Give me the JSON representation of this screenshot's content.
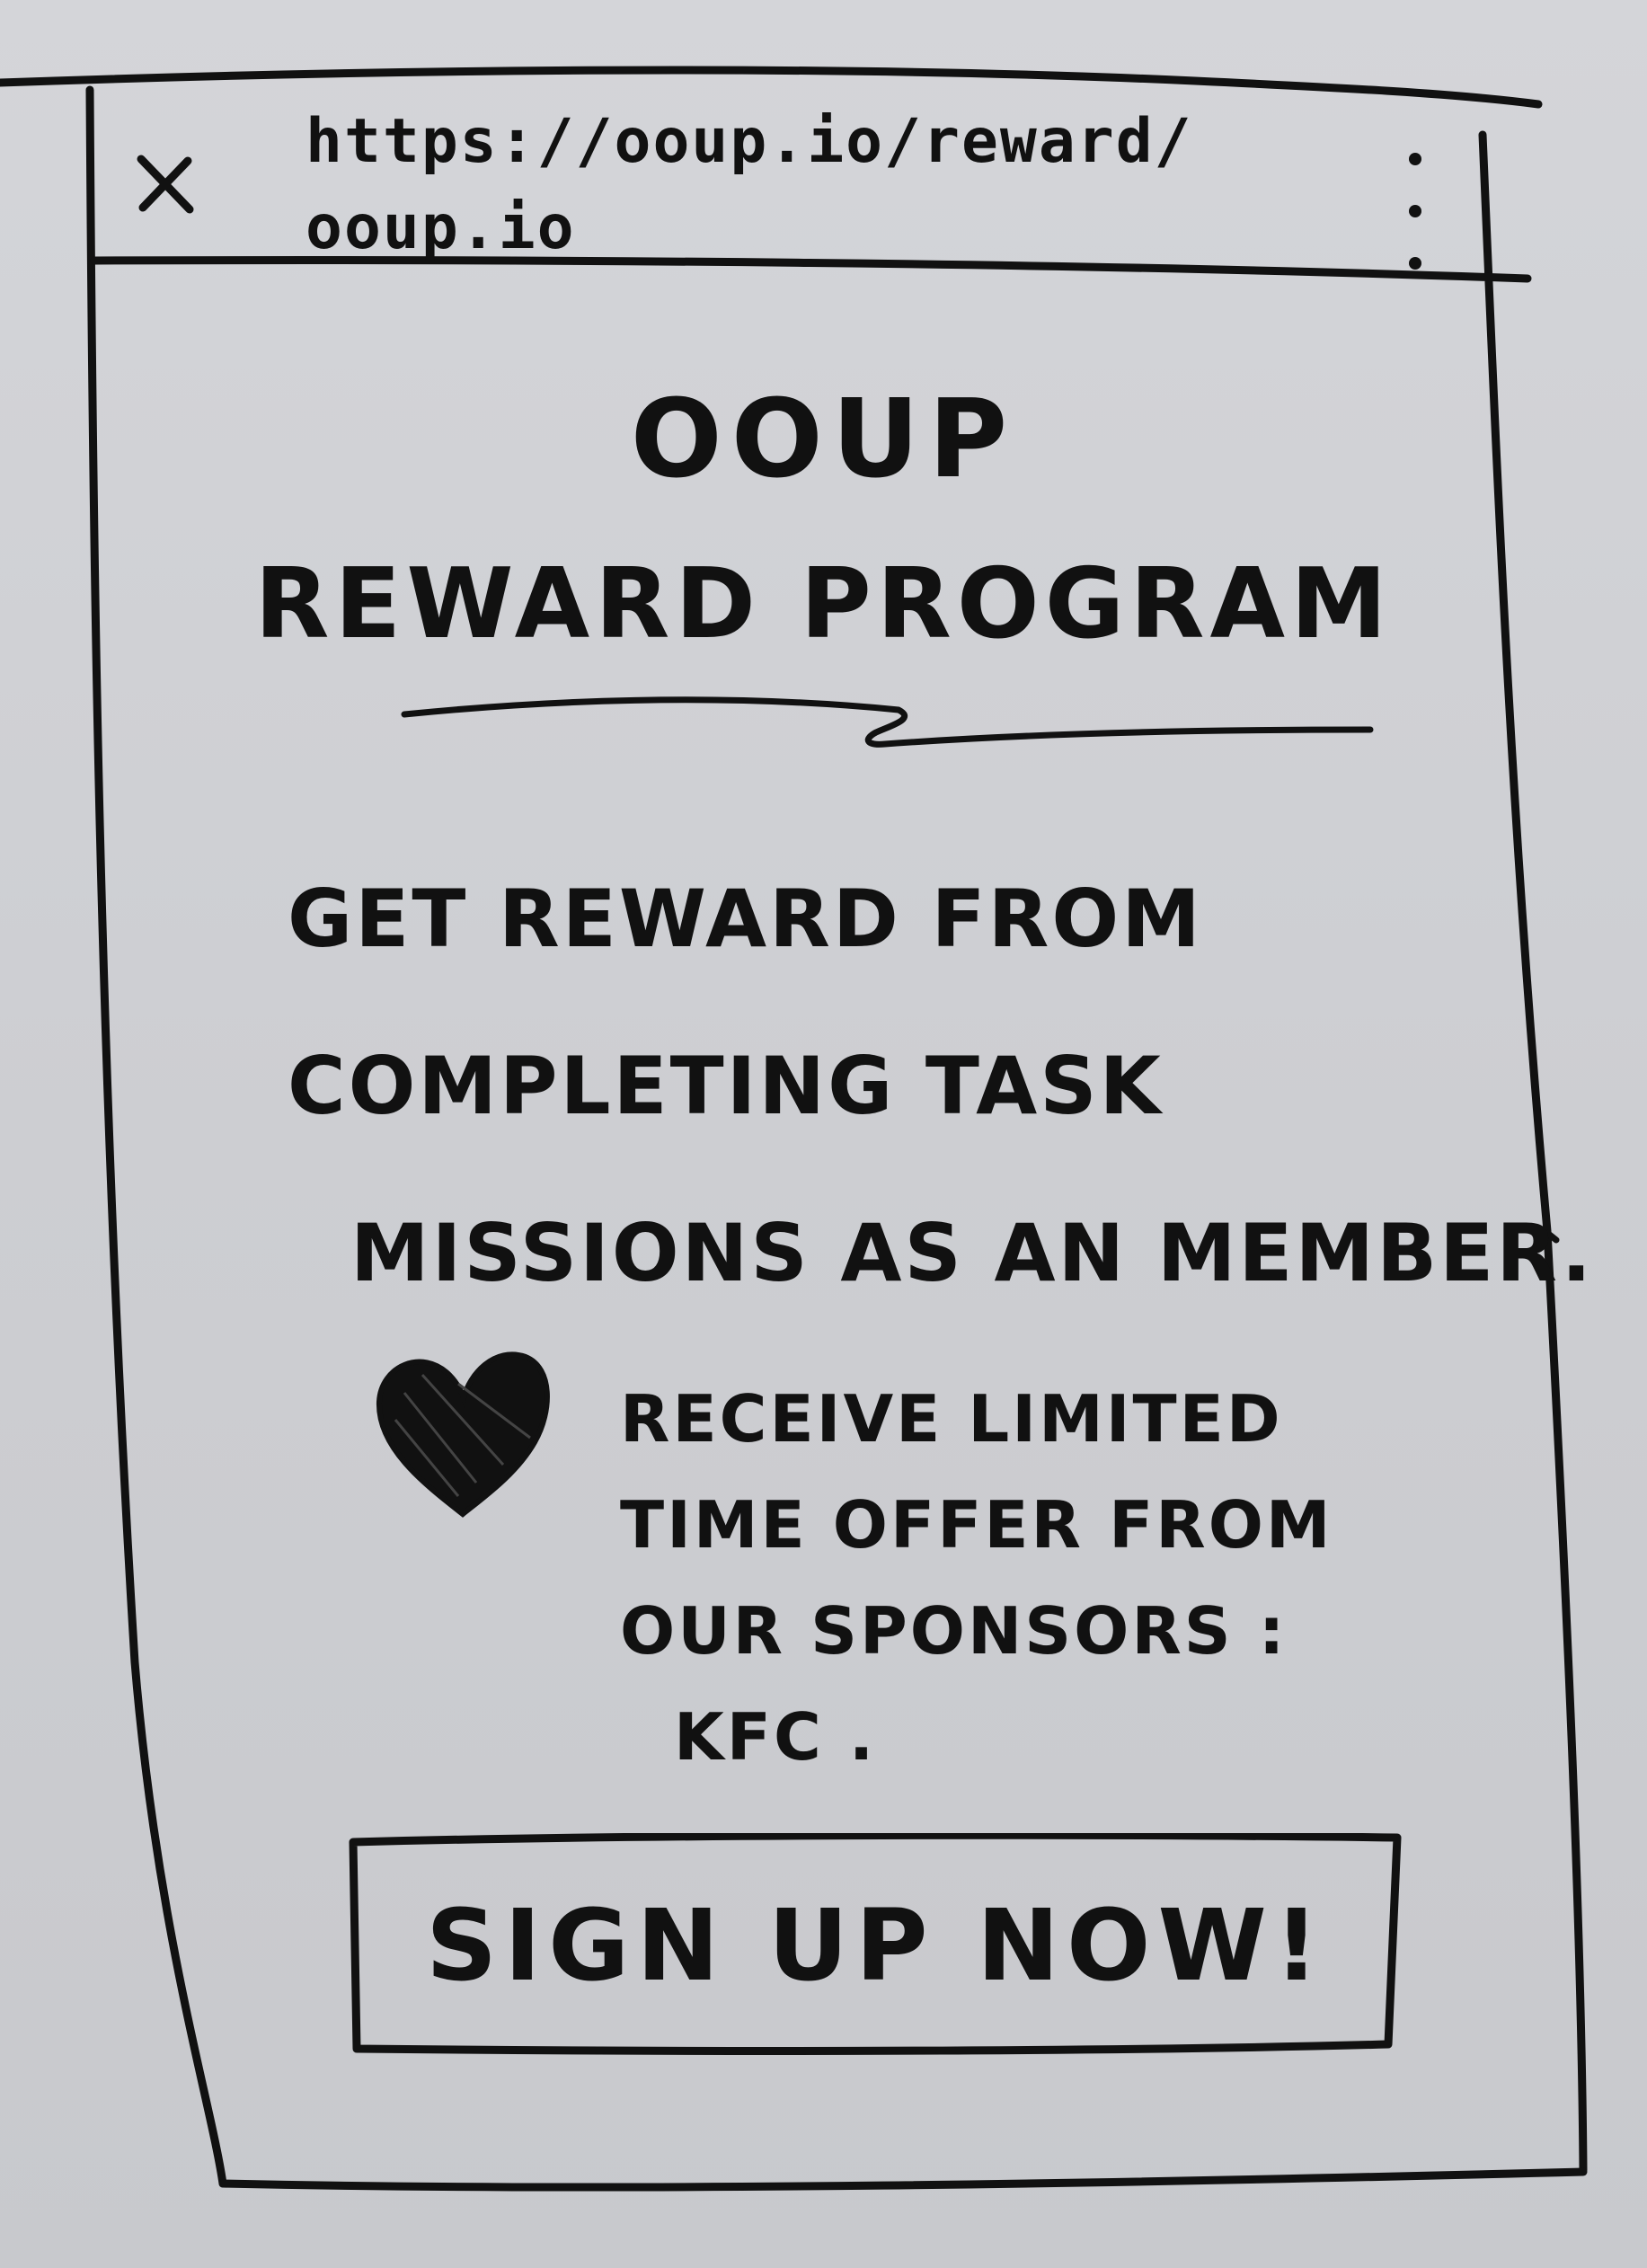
{
  "browser": {
    "close_icon": "close-icon",
    "url_line1": "https://ooup.io/reward/",
    "url_line2": "ooup.io",
    "menu_icon": "kebab-menu-icon"
  },
  "header": {
    "brand": "OOUP",
    "title": "REWARD PROGRAM"
  },
  "main": {
    "description_lines": [
      "GET REWARD FROM",
      "COMPLETING TASK",
      "MISSIONS AS AN MEMBER."
    ],
    "promo_icon": "heart-icon",
    "promo_lines": [
      "RECEIVE LIMITED",
      "TIME OFFER FROM",
      "OUR SPONSORS :",
      "KFC ."
    ],
    "signup_label": "SIGN UP NOW!"
  },
  "colors": {
    "ink": "#111111",
    "paper": "#cfd0d4"
  }
}
